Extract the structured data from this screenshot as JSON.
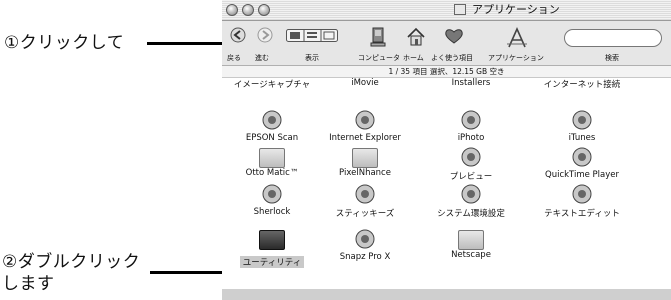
{
  "annotations": {
    "step1": "①クリックして",
    "step2_line1": "②ダブルクリック",
    "step2_line2": "します"
  },
  "window": {
    "title": "アプリケーション"
  },
  "toolbar": {
    "back": "戻る",
    "forward": "進む",
    "view": "表示",
    "computer": "コンピュータ",
    "home": "ホーム",
    "favorites": "よく使う項目",
    "applications": "アプリケーション",
    "search": "検索"
  },
  "status": "1 / 35 項目 選択、12.15 GB 空き",
  "apps": [
    [
      "イメージキャプチャ",
      "iMovie",
      "Installers",
      "インターネット接続"
    ],
    [
      "EPSON Scan",
      "Internet Explorer",
      "iPhoto",
      "iTunes"
    ],
    [
      "Otto Matic™",
      "PixelNhance",
      "プレビュー",
      "QuickTime Player"
    ],
    [
      "Sherlock",
      "スティッキーズ",
      "システム環境設定",
      "テキストエディット"
    ],
    [
      "ユーティリティ",
      "Snapz Pro X",
      "Netscape"
    ]
  ]
}
